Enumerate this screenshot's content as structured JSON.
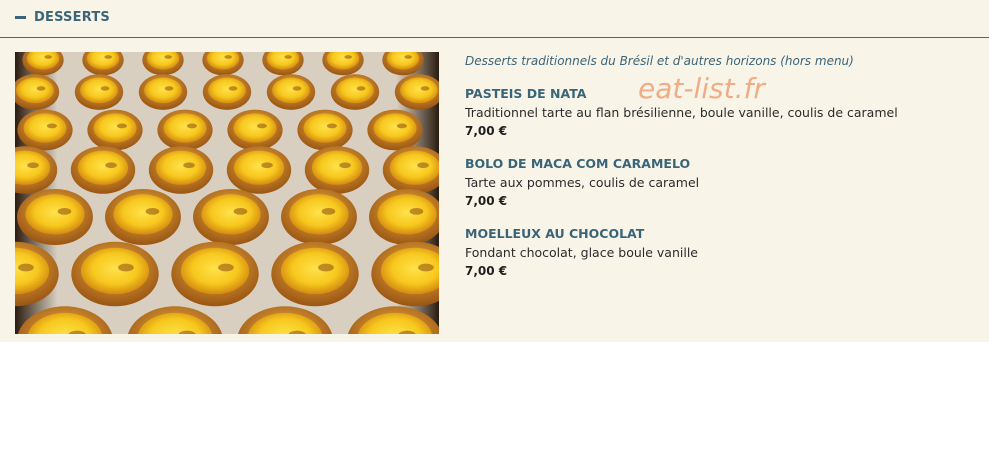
{
  "section": {
    "title": "DESSERTS",
    "collapse_icon": "minus-icon",
    "accent_color": "#3a6478",
    "background_color": "#f8f5e8"
  },
  "photo": {
    "subject": "pasteis-de-nata-tray"
  },
  "intro": "Desserts traditionnels du Brésil et d'autres horizons (hors menu)",
  "watermark": "eat-list.fr",
  "items": [
    {
      "name": "PASTEIS DE NATA",
      "description": "Traditionnel tarte au flan brésilienne, boule vanille, coulis de caramel",
      "price": "7,00 €"
    },
    {
      "name": "BOLO DE MACA COM CARAMELO",
      "description": "Tarte aux pommes, coulis de caramel",
      "price": "7,00 €"
    },
    {
      "name": "MOELLEUX AU CHOCOLAT",
      "description": "Fondant chocolat, glace boule vanille",
      "price": "7,00 €"
    }
  ]
}
